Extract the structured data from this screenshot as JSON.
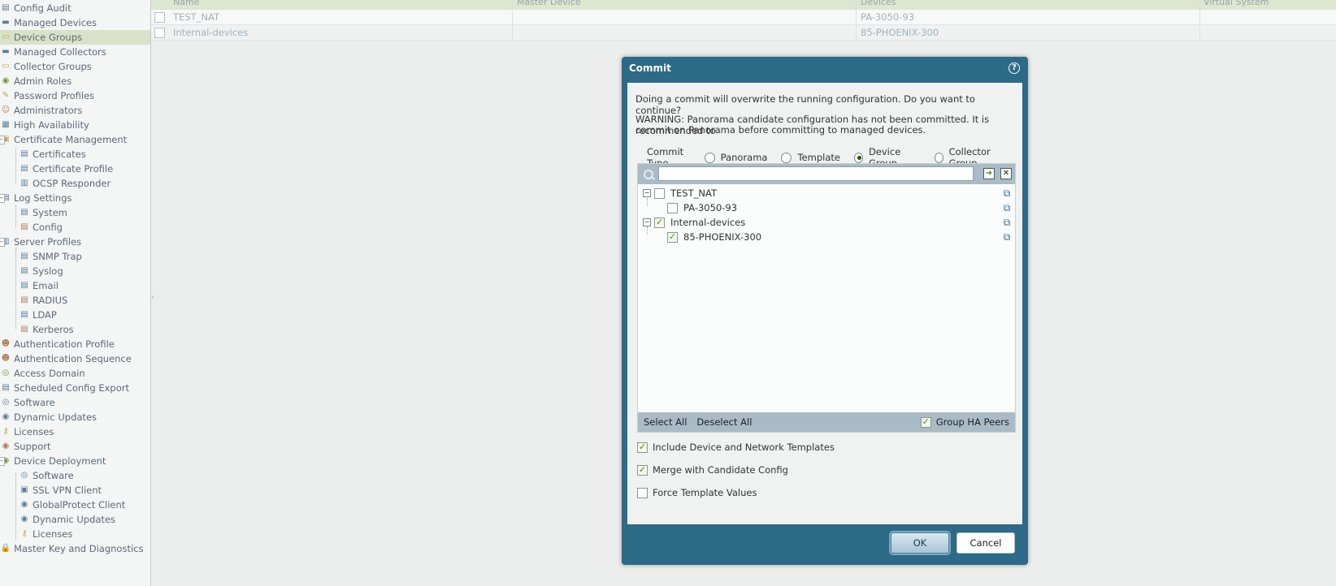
{
  "sidebar": {
    "items": [
      {
        "label": "Config Audit",
        "icon": "config-audit-icon",
        "glyph": "▤",
        "color": "#5a7d9a",
        "indent": 0
      },
      {
        "label": "Managed Devices",
        "icon": "device-icon",
        "glyph": "▬",
        "color": "#5a7d9a",
        "indent": 0
      },
      {
        "label": "Device Groups",
        "icon": "folder-icon",
        "glyph": "▭",
        "color": "#c9a04a",
        "indent": 0,
        "selected": true
      },
      {
        "label": "Managed Collectors",
        "icon": "collector-icon",
        "glyph": "▬",
        "color": "#5a7d9a",
        "indent": 0
      },
      {
        "label": "Collector Groups",
        "icon": "folder-icon",
        "glyph": "▭",
        "color": "#c9a04a",
        "indent": 0
      },
      {
        "label": "Admin Roles",
        "icon": "roles-icon",
        "glyph": "◉",
        "color": "#6d9a3a",
        "indent": 0
      },
      {
        "label": "Password Profiles",
        "icon": "password-icon",
        "glyph": "✎",
        "color": "#c9a04a",
        "indent": 0
      },
      {
        "label": "Administrators",
        "icon": "user-icon",
        "glyph": "☺",
        "color": "#b07a58",
        "indent": 0
      },
      {
        "label": "High Availability",
        "icon": "ha-icon",
        "glyph": "▦",
        "color": "#5a7d9a",
        "indent": 0
      },
      {
        "label": "Certificate Management",
        "icon": "certificate-icon",
        "glyph": "▣",
        "color": "#c9a04a",
        "indent": 0,
        "expandable": true
      },
      {
        "label": "Certificates",
        "icon": "certificate-icon",
        "glyph": "▤",
        "color": "#5a7d9a",
        "indent": 1
      },
      {
        "label": "Certificate Profile",
        "icon": "certificate-icon",
        "glyph": "▤",
        "color": "#5a7d9a",
        "indent": 1
      },
      {
        "label": "OCSP Responder",
        "icon": "ocsp-icon",
        "glyph": "▥",
        "color": "#5a7d9a",
        "indent": 1
      },
      {
        "label": "Log Settings",
        "icon": "log-icon",
        "glyph": "▤",
        "color": "#5a7d9a",
        "indent": 0,
        "expandable": true
      },
      {
        "label": "System",
        "icon": "system-icon",
        "glyph": "▤",
        "color": "#5a7d9a",
        "indent": 1
      },
      {
        "label": "Config",
        "icon": "config-icon",
        "glyph": "▤",
        "color": "#b07a58",
        "indent": 1
      },
      {
        "label": "Server Profiles",
        "icon": "server-icon",
        "glyph": "▥",
        "color": "#5a7d9a",
        "indent": 0,
        "expandable": true
      },
      {
        "label": "SNMP Trap",
        "icon": "snmp-icon",
        "glyph": "▤",
        "color": "#5a7d9a",
        "indent": 1
      },
      {
        "label": "Syslog",
        "icon": "syslog-icon",
        "glyph": "▤",
        "color": "#5a7d9a",
        "indent": 1
      },
      {
        "label": "Email",
        "icon": "email-icon",
        "glyph": "▤",
        "color": "#5a7d9a",
        "indent": 1
      },
      {
        "label": "RADIUS",
        "icon": "radius-icon",
        "glyph": "▤",
        "color": "#b07a58",
        "indent": 1
      },
      {
        "label": "LDAP",
        "icon": "ldap-icon",
        "glyph": "▤",
        "color": "#5a7d9a",
        "indent": 1
      },
      {
        "label": "Kerberos",
        "icon": "kerberos-icon",
        "glyph": "▤",
        "color": "#b07a58",
        "indent": 1
      },
      {
        "label": "Authentication Profile",
        "icon": "auth-profile-icon",
        "glyph": "☻",
        "color": "#b07a58",
        "indent": 0
      },
      {
        "label": "Authentication Sequence",
        "icon": "auth-sequence-icon",
        "glyph": "☻",
        "color": "#b07a58",
        "indent": 0
      },
      {
        "label": "Access Domain",
        "icon": "access-domain-icon",
        "glyph": "◎",
        "color": "#6d9a3a",
        "indent": 0
      },
      {
        "label": "Scheduled Config Export",
        "icon": "export-icon",
        "glyph": "▤",
        "color": "#5a7d9a",
        "indent": 0
      },
      {
        "label": "Software",
        "icon": "software-icon",
        "glyph": "◎",
        "color": "#5a7d9a",
        "indent": 0
      },
      {
        "label": "Dynamic Updates",
        "icon": "updates-icon",
        "glyph": "◉",
        "color": "#5a7d9a",
        "indent": 0
      },
      {
        "label": "Licenses",
        "icon": "key-icon",
        "glyph": "⚷",
        "color": "#c9a04a",
        "indent": 0
      },
      {
        "label": "Support",
        "icon": "support-icon",
        "glyph": "◉",
        "color": "#b07a58",
        "indent": 0
      },
      {
        "label": "Device Deployment",
        "icon": "deployment-icon",
        "glyph": "◉",
        "color": "#6d9a3a",
        "indent": 0,
        "expandable": true
      },
      {
        "label": "Software",
        "icon": "software-icon",
        "glyph": "◎",
        "color": "#5a7d9a",
        "indent": 1
      },
      {
        "label": "SSL VPN Client",
        "icon": "vpn-icon",
        "glyph": "▣",
        "color": "#5a7d9a",
        "indent": 1
      },
      {
        "label": "GlobalProtect Client",
        "icon": "globalprotect-icon",
        "glyph": "◉",
        "color": "#5a7d9a",
        "indent": 1
      },
      {
        "label": "Dynamic Updates",
        "icon": "updates-icon",
        "glyph": "◉",
        "color": "#5a7d9a",
        "indent": 1
      },
      {
        "label": "Licenses",
        "icon": "key-icon",
        "glyph": "⚷",
        "color": "#c9a04a",
        "indent": 1
      },
      {
        "label": "Master Key and Diagnostics",
        "icon": "lock-icon",
        "glyph": "🔒",
        "color": "#c9a04a",
        "indent": 0
      }
    ]
  },
  "grid": {
    "columns": [
      "Name",
      "Master Device",
      "Devices",
      "Virtual System"
    ],
    "rows": [
      {
        "name": "TEST_NAT",
        "master": "",
        "devices": "PA-3050-93",
        "vsys": ""
      },
      {
        "name": "Internal-devices",
        "master": "",
        "devices": "85-PHOENIX-300",
        "vsys": ""
      }
    ]
  },
  "dialog": {
    "title": "Commit",
    "message": "Doing a commit will overwrite the running configuration. Do you want to continue?",
    "warning_line1": "WARNING: Panorama candidate configuration has not been committed. It is recommended to",
    "warning_line2": "commit on Panorama before committing to managed devices.",
    "commit_type_label": "Commit Type",
    "commit_types": [
      {
        "label": "Panorama",
        "selected": false
      },
      {
        "label": "Template",
        "selected": false
      },
      {
        "label": "Device Group",
        "selected": true
      },
      {
        "label": "Collector Group",
        "selected": false
      }
    ],
    "search": {
      "value": "",
      "placeholder": ""
    },
    "tree": [
      {
        "label": "TEST_NAT",
        "checked": false,
        "level": 0
      },
      {
        "label": "PA-3050-93",
        "checked": false,
        "level": 1
      },
      {
        "label": "Internal-devices",
        "checked": true,
        "level": 0
      },
      {
        "label": "85-PHOENIX-300",
        "checked": true,
        "level": 1
      }
    ],
    "select_all": "Select All",
    "deselect_all": "Deselect All",
    "group_ha_peers": "Group HA Peers",
    "group_ha_checked": true,
    "options": [
      {
        "label": "Include Device and Network Templates",
        "checked": true
      },
      {
        "label": "Merge with Candidate Config",
        "checked": true
      },
      {
        "label": "Force Template Values",
        "checked": false
      }
    ],
    "ok_label": "OK",
    "cancel_label": "Cancel",
    "check_glyph": "✓"
  }
}
